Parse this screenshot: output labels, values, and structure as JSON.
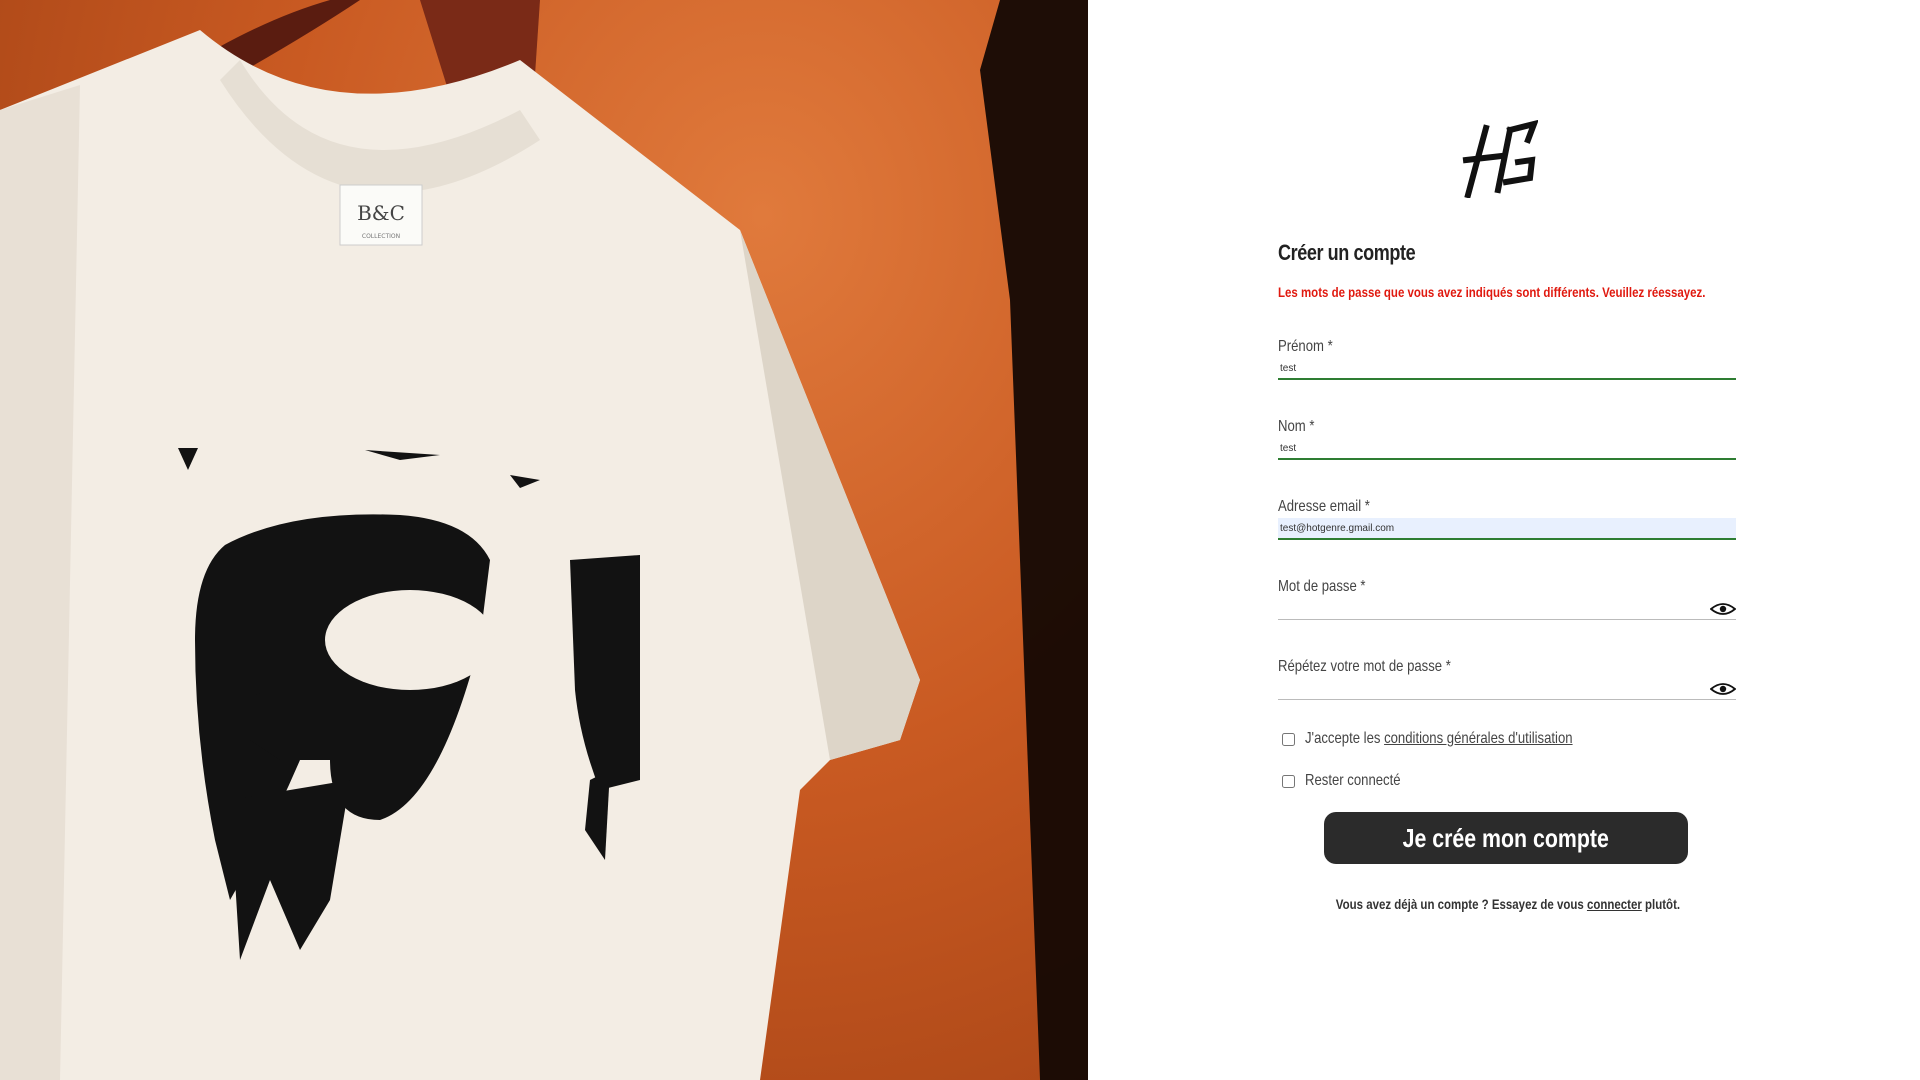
{
  "form": {
    "title": "Créer un compte",
    "error": "Les mots de passe que vous avez indiqués sont différents. Veuillez réessayez.",
    "fields": [
      {
        "label": "Prénom *",
        "value": "test"
      },
      {
        "label": "Nom *",
        "value": "test"
      },
      {
        "label": "Adresse email *",
        "value": "test@hotgenre.gmail.com"
      },
      {
        "label": "Mot de passe *",
        "value": ""
      },
      {
        "label": "Répétez votre mot de passe *",
        "value": ""
      }
    ],
    "terms_prefix": "J'accepte les ",
    "terms_link": "conditions générales d'utilisation",
    "remember_label": "Rester connecté",
    "submit_label": "Je crée mon compte",
    "login_prefix": "Vous avez déjà un compte ? Essayez de vous ",
    "login_link": "connecter",
    "login_suffix": " plutôt."
  },
  "hero": {
    "tag_brand": "B&C",
    "tag_text": "COLLECTION"
  },
  "colors": {
    "accent": "#2e7d32",
    "error": "#e0190f",
    "button": "#2b2b2b",
    "autofill": "#e8f0fe"
  },
  "icons": [
    "hotgenre-logo-icon",
    "eye-icon"
  ]
}
